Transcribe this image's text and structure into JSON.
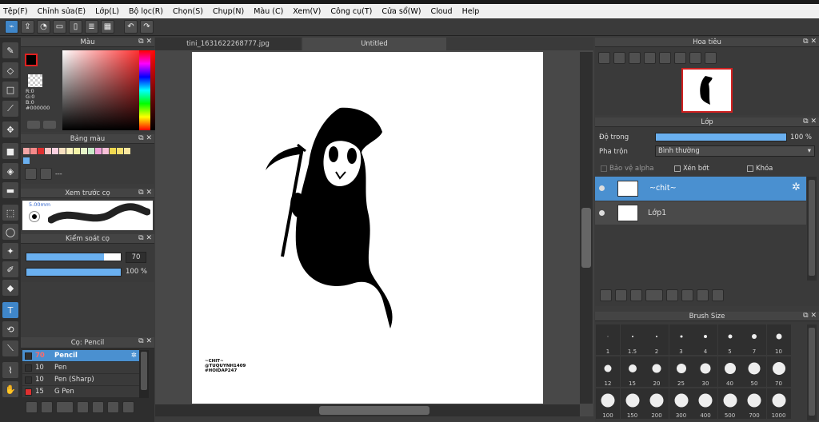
{
  "menu": [
    "Tệp(F)",
    "Chỉnh sửa(E)",
    "Lớp(L)",
    "Bộ lọc(R)",
    "Chọn(S)",
    "Chụp(N)",
    "Màu (C)",
    "Xem(V)",
    "Công cụ(T)",
    "Cửa sổ(W)",
    "Cloud",
    "Help"
  ],
  "toolbar_icons": [
    "snap-icon",
    "export-icon",
    "chat-icon",
    "comment-icon",
    "page-icon",
    "list-icon",
    "grid-icon",
    "undo-icon",
    "redo-icon"
  ],
  "color_panel": {
    "title": "Màu",
    "r": "R:0",
    "g": "G:0",
    "b": "B:0",
    "hex": "#000000",
    "primary": "#000000",
    "secondary": "#ffffff"
  },
  "palette_panel": {
    "title": "Bảng màu",
    "swatches": [
      "#f4a6a6",
      "#f58a8a",
      "#e03030",
      "#f8c6c6",
      "#fbd0e0",
      "#f8e0c0",
      "#fff4c0",
      "#f4f4a8",
      "#e6f4c8",
      "#c8eac8",
      "#f0a0d8",
      "#f8c0d8",
      "#f0d850",
      "#f8e070",
      "#fae6a0",
      "#6ab0f0"
    ],
    "footer": "---"
  },
  "brush_preview": {
    "title": "Xem trước cọ",
    "size": "5.00mm"
  },
  "brush_control": {
    "title": "Kiểm soát cọ",
    "size_value": "70",
    "size_fill": 0.82,
    "opacity_value": "100 %",
    "opacity_fill": 1.0
  },
  "brush_list": {
    "title": "Cọ: Pencil",
    "items": [
      {
        "size": "70",
        "name": "Pencil",
        "color": "#303030",
        "selected": true
      },
      {
        "size": "10",
        "name": "Pen",
        "color": "#303030",
        "selected": false
      },
      {
        "size": "10",
        "name": "Pen (Sharp)",
        "color": "#303030",
        "selected": false
      },
      {
        "size": "15",
        "name": "G Pen",
        "color": "#e03030",
        "selected": false
      }
    ]
  },
  "tabs": [
    "tini_1631622268777.jpg",
    "Untitled"
  ],
  "canvas_text": [
    "~CHIT~",
    "@TUQUYNH1409",
    "#HOIDAP247"
  ],
  "navigator": {
    "title": "Hoa tiêu"
  },
  "layer_panel": {
    "title": "Lớp",
    "opacity_label": "Độ trong",
    "opacity_value": "100 %",
    "opacity_fill": 1.0,
    "blend_label": "Pha trộn",
    "blend_value": "Bình thường",
    "protect_alpha": "Bảo vệ alpha",
    "clip": "Xén bớt",
    "lock": "Khóa",
    "layers": [
      {
        "name": "~chit~",
        "selected": true
      },
      {
        "name": "Lớp1",
        "selected": false
      }
    ]
  },
  "brush_size_panel": {
    "title": "Brush Size",
    "sizes": [
      "1",
      "1.5",
      "2",
      "3",
      "4",
      "5",
      "7",
      "10",
      "12",
      "15",
      "20",
      "25",
      "30",
      "40",
      "50",
      "70",
      "100",
      "150",
      "200",
      "300",
      "400",
      "500",
      "700",
      "1000"
    ]
  }
}
